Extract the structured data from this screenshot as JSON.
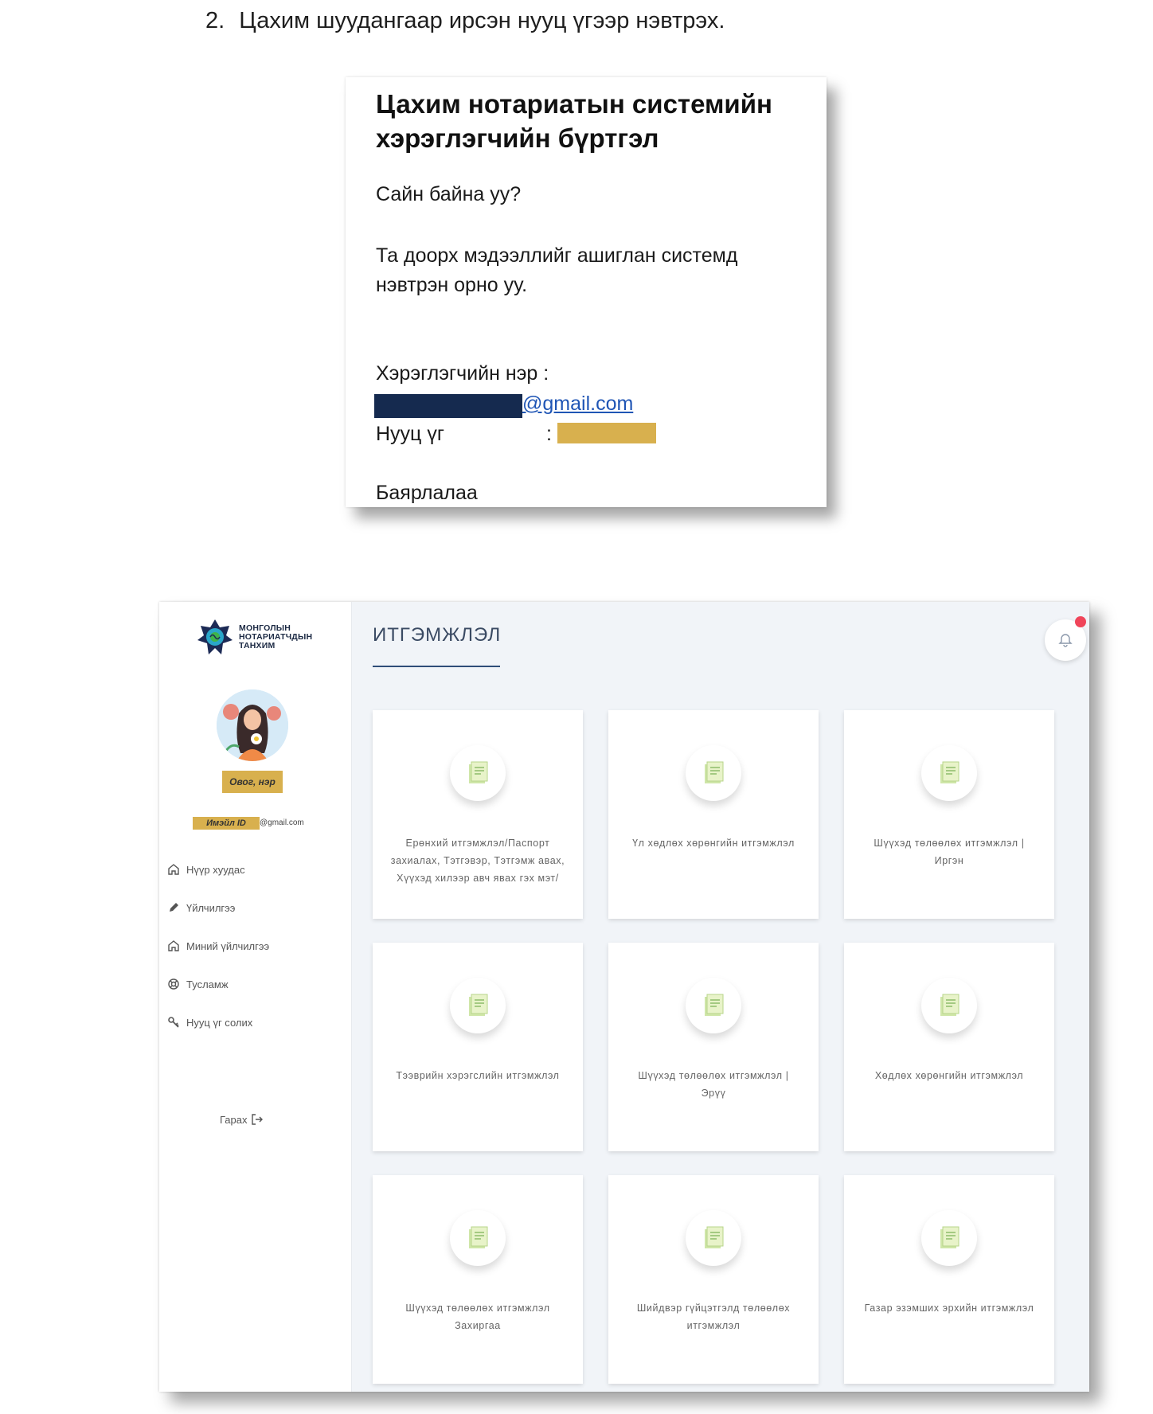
{
  "step": {
    "number": "2.",
    "text": "Цахим шуудангаар ирсэн нууц үгээр нэвтрэх."
  },
  "email": {
    "title": "Цахим нотариатын системийн хэрэглэгчийн бүртгэл",
    "greeting": "Сайн байна уу?",
    "body": "Та доорх мэдээллийг ашиглан системд нэвтрэн орно уу.",
    "username_label": "Хэрэглэгчийн нэр :",
    "email_domain": "@gmail.com",
    "password_label": "Нууц үг",
    "password_colon": ":",
    "thanks": "Баярлалаа"
  },
  "app": {
    "logo_text": "МОНГОЛЫН НОТАРИАТЧДЫН ТАНХИМ",
    "user_name_badge": "Овог, нэр",
    "email_id_badge": "Имэйл ID",
    "email_domain": "@gmail.com",
    "nav": [
      {
        "label": "Нүүр хуудас",
        "icon": "home-icon"
      },
      {
        "label": "Үйлчилгээ",
        "icon": "pencil-icon"
      },
      {
        "label": "Миний үйлчилгээ",
        "icon": "home-icon"
      },
      {
        "label": "Тусламж",
        "icon": "lifebuoy-icon"
      },
      {
        "label": "Нууц үг солих",
        "icon": "key-icon"
      }
    ],
    "logout_label": "Гарах",
    "page_title": "ИТГЭМЖЛЭЛ",
    "cards": [
      "Ерөнхий итгэмжлэл/Паспорт захиалах, Тэтгэвэр, Тэтгэмж авах, Хүүхэд хилээр авч явах гэх мэт/",
      "Үл хөдлөх хөрөнгийн итгэмжлэл",
      "Шүүхэд төлөөлөх итгэмжлэл | Иргэн",
      "Тээврийн хэрэгслийн итгэмжлэл",
      "Шүүхэд төлөөлөх итгэмжлэл | Эрүү",
      "Хөдлөх хөрөнгийн итгэмжлэл",
      "Шүүхэд төлөөлөх итгэмжлэл Захиргаа",
      "Шийдвэр гүйцэтгэлд төлөөлөх итгэмжлэл",
      "Газар эзэмших эрхийн итгэмжлэл"
    ]
  },
  "colors": {
    "redaction_dark": "#152a4f",
    "redaction_gold": "#d8b04e",
    "link_blue": "#1f55b5",
    "notification_dot": "#f0455a",
    "title_underline": "#2f4d78"
  }
}
